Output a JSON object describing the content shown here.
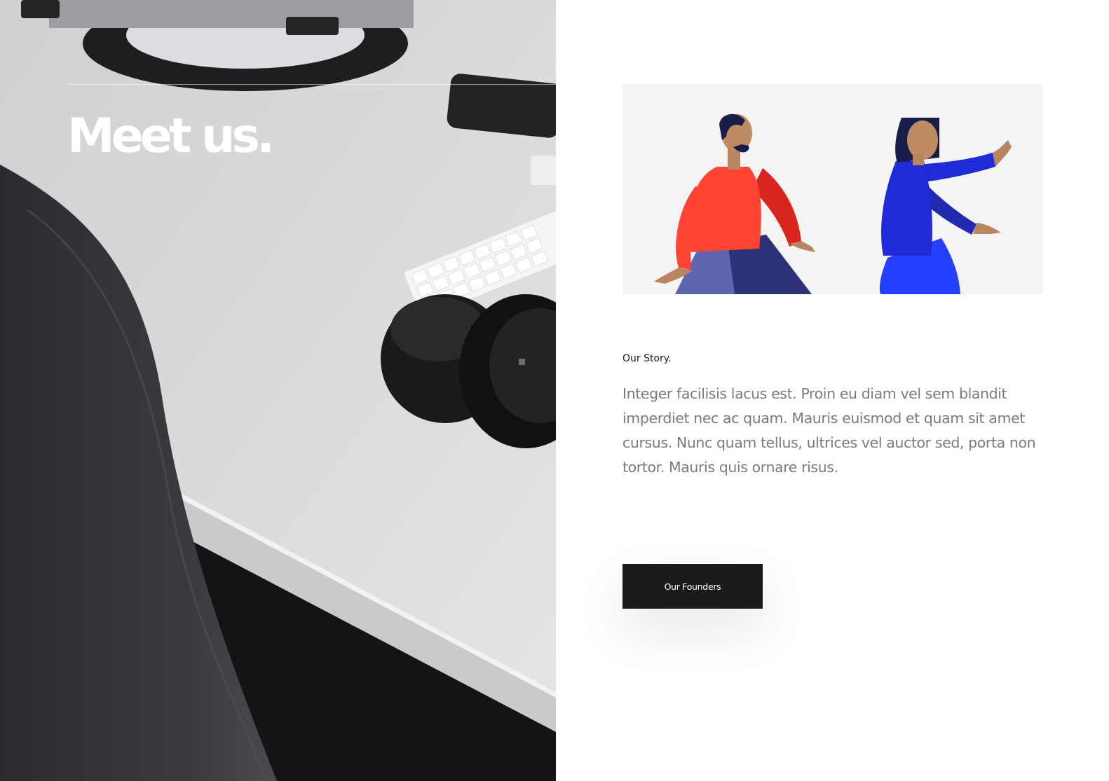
{
  "hero": {
    "title": "Meet us."
  },
  "section": {
    "kicker": "Our Story.",
    "body": "Integer facilisis lacus est. Proin eu diam vel sem blandit imperdiet nec ac quam. Mauris euismod et quam sit amet cursus. Nunc quam tellus, ultrices vel auctor sed, porta non tortor. Mauris quis ornare risus.",
    "cta_label": "Our Founders"
  },
  "colors": {
    "button_bg": "#1b1b1b",
    "illustration_bg": "#f4f4f4",
    "man_top": "#ff4433",
    "woman_top": "#1f2bd6",
    "text_muted": "#7b7b7b"
  },
  "icons": {
    "man_figure": "walking-man-figure",
    "woman_figure": "pointing-woman-figure"
  }
}
